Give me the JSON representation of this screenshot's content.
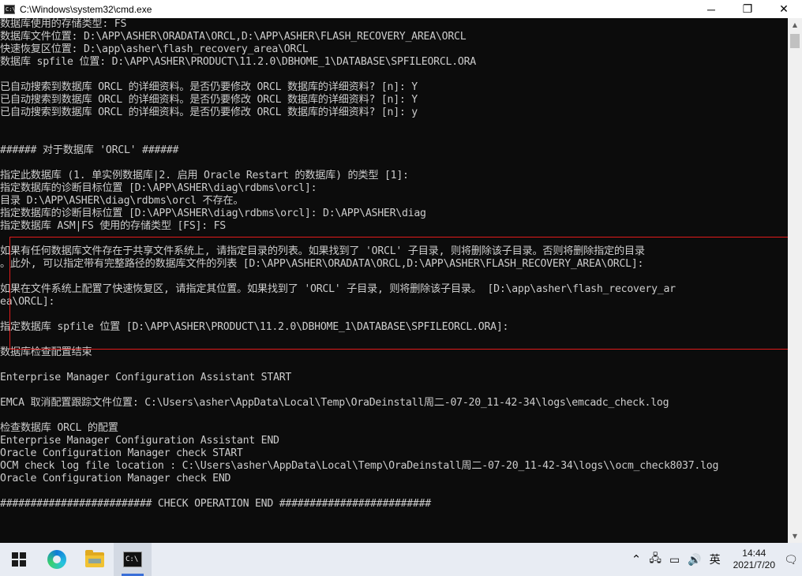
{
  "window": {
    "icon_text": "C:\\",
    "title": "C:\\Windows\\system32\\cmd.exe",
    "minimize_glyph": "─",
    "maximize_glyph": "❐",
    "close_glyph": "✕"
  },
  "console": {
    "lines": [
      "数据库使用的存储类型: FS",
      "数据库文件位置: D:\\APP\\ASHER\\ORADATA\\ORCL,D:\\APP\\ASHER\\FLASH_RECOVERY_AREA\\ORCL",
      "快速恢复区位置: D:\\app\\asher\\flash_recovery_area\\ORCL",
      "数据库 spfile 位置: D:\\APP\\ASHER\\PRODUCT\\11.2.0\\DBHOME_1\\DATABASE\\SPFILEORCL.ORA",
      "",
      "已自动搜索到数据库 ORCL 的详细资料。是否仍要修改 ORCL 数据库的详细资料? [n]: Y",
      "已自动搜索到数据库 ORCL 的详细资料。是否仍要修改 ORCL 数据库的详细资料? [n]: Y",
      "已自动搜索到数据库 ORCL 的详细资料。是否仍要修改 ORCL 数据库的详细资料? [n]: y",
      "",
      "",
      "###### 对于数据库 'ORCL' ######",
      "",
      "指定此数据库 (1. 单实例数据库|2. 启用 Oracle Restart 的数据库) 的类型 [1]:",
      "指定数据库的诊断目标位置 [D:\\APP\\ASHER\\diag\\rdbms\\orcl]:",
      "目录 D:\\APP\\ASHER\\diag\\rdbms\\orcl 不存在。",
      "指定数据库的诊断目标位置 [D:\\APP\\ASHER\\diag\\rdbms\\orcl]: D:\\APP\\ASHER\\diag",
      "指定数据库 ASM|FS 使用的存储类型 [FS]: FS",
      "",
      "如果有任何数据库文件存在于共享文件系统上, 请指定目录的列表。如果找到了 'ORCL' 子目录, 则将删除该子目录。否则将删除指定的目录",
      "。此外, 可以指定带有完整路径的数据库文件的列表 [D:\\APP\\ASHER\\ORADATA\\ORCL,D:\\APP\\ASHER\\FLASH_RECOVERY_AREA\\ORCL]:",
      "",
      "如果在文件系统上配置了快速恢复区, 请指定其位置。如果找到了 'ORCL' 子目录, 则将删除该子目录。 [D:\\app\\asher\\flash_recovery_ar",
      "ea\\ORCL]:",
      "",
      "指定数据库 spfile 位置 [D:\\APP\\ASHER\\PRODUCT\\11.2.0\\DBHOME_1\\DATABASE\\SPFILEORCL.ORA]:",
      "",
      "数据库检查配置结束",
      "",
      "Enterprise Manager Configuration Assistant START",
      "",
      "EMCA 取消配置跟踪文件位置: C:\\Users\\asher\\AppData\\Local\\Temp\\OraDeinstall周二-07-20_11-42-34\\logs\\emcadc_check.log",
      "",
      "检查数据库 ORCL 的配置",
      "Enterprise Manager Configuration Assistant END",
      "Oracle Configuration Manager check START",
      "OCM check log file location : C:\\Users\\asher\\AppData\\Local\\Temp\\OraDeinstall周二-07-20_11-42-34\\logs\\\\ocm_check8037.log",
      "Oracle Configuration Manager check END",
      "",
      "######################### CHECK OPERATION END #########################"
    ]
  },
  "scrollbar": {
    "up_glyph": "▲",
    "down_glyph": "▼"
  },
  "taskbar": {
    "tray_chevron": "⌃",
    "tray_network": "🖧",
    "tray_battery": "▭",
    "tray_volume": "🔊",
    "ime": "英",
    "time": "14:44",
    "date": "2021/7/20",
    "notification_glyph": "🗨"
  }
}
